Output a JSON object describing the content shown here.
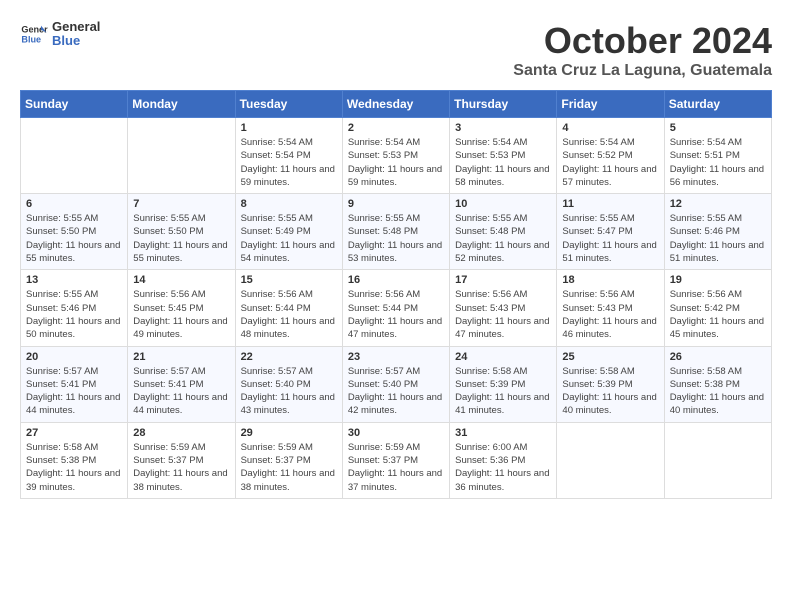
{
  "header": {
    "logo_line1": "General",
    "logo_line2": "Blue",
    "month": "October 2024",
    "location": "Santa Cruz La Laguna, Guatemala"
  },
  "days_of_week": [
    "Sunday",
    "Monday",
    "Tuesday",
    "Wednesday",
    "Thursday",
    "Friday",
    "Saturday"
  ],
  "weeks": [
    [
      {
        "day": "",
        "text": ""
      },
      {
        "day": "",
        "text": ""
      },
      {
        "day": "1",
        "text": "Sunrise: 5:54 AM\nSunset: 5:54 PM\nDaylight: 11 hours and 59 minutes."
      },
      {
        "day": "2",
        "text": "Sunrise: 5:54 AM\nSunset: 5:53 PM\nDaylight: 11 hours and 59 minutes."
      },
      {
        "day": "3",
        "text": "Sunrise: 5:54 AM\nSunset: 5:53 PM\nDaylight: 11 hours and 58 minutes."
      },
      {
        "day": "4",
        "text": "Sunrise: 5:54 AM\nSunset: 5:52 PM\nDaylight: 11 hours and 57 minutes."
      },
      {
        "day": "5",
        "text": "Sunrise: 5:54 AM\nSunset: 5:51 PM\nDaylight: 11 hours and 56 minutes."
      }
    ],
    [
      {
        "day": "6",
        "text": "Sunrise: 5:55 AM\nSunset: 5:50 PM\nDaylight: 11 hours and 55 minutes."
      },
      {
        "day": "7",
        "text": "Sunrise: 5:55 AM\nSunset: 5:50 PM\nDaylight: 11 hours and 55 minutes."
      },
      {
        "day": "8",
        "text": "Sunrise: 5:55 AM\nSunset: 5:49 PM\nDaylight: 11 hours and 54 minutes."
      },
      {
        "day": "9",
        "text": "Sunrise: 5:55 AM\nSunset: 5:48 PM\nDaylight: 11 hours and 53 minutes."
      },
      {
        "day": "10",
        "text": "Sunrise: 5:55 AM\nSunset: 5:48 PM\nDaylight: 11 hours and 52 minutes."
      },
      {
        "day": "11",
        "text": "Sunrise: 5:55 AM\nSunset: 5:47 PM\nDaylight: 11 hours and 51 minutes."
      },
      {
        "day": "12",
        "text": "Sunrise: 5:55 AM\nSunset: 5:46 PM\nDaylight: 11 hours and 51 minutes."
      }
    ],
    [
      {
        "day": "13",
        "text": "Sunrise: 5:55 AM\nSunset: 5:46 PM\nDaylight: 11 hours and 50 minutes."
      },
      {
        "day": "14",
        "text": "Sunrise: 5:56 AM\nSunset: 5:45 PM\nDaylight: 11 hours and 49 minutes."
      },
      {
        "day": "15",
        "text": "Sunrise: 5:56 AM\nSunset: 5:44 PM\nDaylight: 11 hours and 48 minutes."
      },
      {
        "day": "16",
        "text": "Sunrise: 5:56 AM\nSunset: 5:44 PM\nDaylight: 11 hours and 47 minutes."
      },
      {
        "day": "17",
        "text": "Sunrise: 5:56 AM\nSunset: 5:43 PM\nDaylight: 11 hours and 47 minutes."
      },
      {
        "day": "18",
        "text": "Sunrise: 5:56 AM\nSunset: 5:43 PM\nDaylight: 11 hours and 46 minutes."
      },
      {
        "day": "19",
        "text": "Sunrise: 5:56 AM\nSunset: 5:42 PM\nDaylight: 11 hours and 45 minutes."
      }
    ],
    [
      {
        "day": "20",
        "text": "Sunrise: 5:57 AM\nSunset: 5:41 PM\nDaylight: 11 hours and 44 minutes."
      },
      {
        "day": "21",
        "text": "Sunrise: 5:57 AM\nSunset: 5:41 PM\nDaylight: 11 hours and 44 minutes."
      },
      {
        "day": "22",
        "text": "Sunrise: 5:57 AM\nSunset: 5:40 PM\nDaylight: 11 hours and 43 minutes."
      },
      {
        "day": "23",
        "text": "Sunrise: 5:57 AM\nSunset: 5:40 PM\nDaylight: 11 hours and 42 minutes."
      },
      {
        "day": "24",
        "text": "Sunrise: 5:58 AM\nSunset: 5:39 PM\nDaylight: 11 hours and 41 minutes."
      },
      {
        "day": "25",
        "text": "Sunrise: 5:58 AM\nSunset: 5:39 PM\nDaylight: 11 hours and 40 minutes."
      },
      {
        "day": "26",
        "text": "Sunrise: 5:58 AM\nSunset: 5:38 PM\nDaylight: 11 hours and 40 minutes."
      }
    ],
    [
      {
        "day": "27",
        "text": "Sunrise: 5:58 AM\nSunset: 5:38 PM\nDaylight: 11 hours and 39 minutes."
      },
      {
        "day": "28",
        "text": "Sunrise: 5:59 AM\nSunset: 5:37 PM\nDaylight: 11 hours and 38 minutes."
      },
      {
        "day": "29",
        "text": "Sunrise: 5:59 AM\nSunset: 5:37 PM\nDaylight: 11 hours and 38 minutes."
      },
      {
        "day": "30",
        "text": "Sunrise: 5:59 AM\nSunset: 5:37 PM\nDaylight: 11 hours and 37 minutes."
      },
      {
        "day": "31",
        "text": "Sunrise: 6:00 AM\nSunset: 5:36 PM\nDaylight: 11 hours and 36 minutes."
      },
      {
        "day": "",
        "text": ""
      },
      {
        "day": "",
        "text": ""
      }
    ]
  ]
}
